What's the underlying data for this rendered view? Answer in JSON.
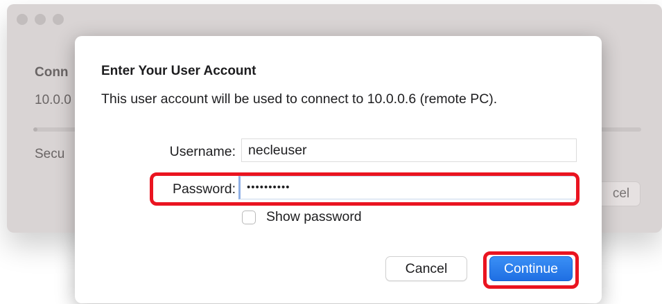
{
  "background_window": {
    "title_partial": "Conn",
    "ip_partial": "10.0.0",
    "secure_partial": "Secu",
    "cancel_partial": "cel"
  },
  "dialog": {
    "title": "Enter Your User Account",
    "description": "This user account will be used to connect to 10.0.0.6 (remote PC).",
    "username_label": "Username:",
    "username_value": "necleuser",
    "password_label": "Password:",
    "password_masked": "••••••••••",
    "show_password_label": "Show password",
    "show_password_checked": false,
    "cancel_label": "Cancel",
    "continue_label": "Continue"
  },
  "colors": {
    "highlight": "#ea1420",
    "primary_button": "#1f6fe3"
  }
}
